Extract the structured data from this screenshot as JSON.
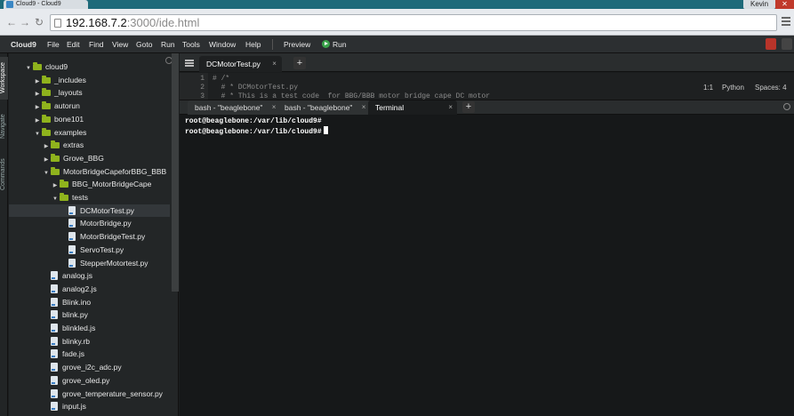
{
  "browser": {
    "tab_title": "Cloud9 - Cloud9",
    "user_name": "Kevin",
    "url_host": "192.168.7.2",
    "url_rest": ":3000/ide.html",
    "back_glyph": "←",
    "forward_glyph": "→",
    "reload_glyph": "↻",
    "minimize_glyph": "—",
    "maximize_glyph": "□",
    "close_glyph": "✕"
  },
  "menubar": {
    "brand": "Cloud9",
    "items": [
      "File",
      "Edit",
      "Find",
      "View",
      "Goto",
      "Run",
      "Tools",
      "Window",
      "Help"
    ],
    "preview": "Preview",
    "run": "Run"
  },
  "rail": {
    "items": [
      "Workspace",
      "Navigate",
      "Commands"
    ]
  },
  "tree": {
    "nodes": [
      {
        "label": "cloud9",
        "kind": "folder",
        "open": true
      },
      {
        "label": "_includes",
        "kind": "folder",
        "open": false
      },
      {
        "label": "_layouts",
        "kind": "folder",
        "open": false
      },
      {
        "label": "autorun",
        "kind": "folder",
        "open": false
      },
      {
        "label": "bone101",
        "kind": "folder",
        "open": false
      },
      {
        "label": "examples",
        "kind": "folder",
        "open": true
      },
      {
        "label": "extras",
        "kind": "folder",
        "open": false
      },
      {
        "label": "Grove_BBG",
        "kind": "folder",
        "open": false
      },
      {
        "label": "MotorBridgeCapeforBBG_BBB",
        "kind": "folder",
        "open": true
      },
      {
        "label": "BBG_MotorBridgeCape",
        "kind": "folder",
        "open": false
      },
      {
        "label": "tests",
        "kind": "folder",
        "open": true
      },
      {
        "label": "DCMotorTest.py",
        "kind": "file"
      },
      {
        "label": "MotorBridge.py",
        "kind": "file"
      },
      {
        "label": "MotorBridgeTest.py",
        "kind": "file"
      },
      {
        "label": "ServoTest.py",
        "kind": "file"
      },
      {
        "label": "StepperMotortest.py",
        "kind": "file"
      },
      {
        "label": "analog.js",
        "kind": "file"
      },
      {
        "label": "analog2.js",
        "kind": "file"
      },
      {
        "label": "Blink.ino",
        "kind": "file"
      },
      {
        "label": "blink.py",
        "kind": "file"
      },
      {
        "label": "blinkled.js",
        "kind": "file"
      },
      {
        "label": "blinky.rb",
        "kind": "file"
      },
      {
        "label": "fade.js",
        "kind": "file"
      },
      {
        "label": "grove_i2c_adc.py",
        "kind": "file"
      },
      {
        "label": "grove_oled.py",
        "kind": "file"
      },
      {
        "label": "grove_temperature_sensor.py",
        "kind": "file"
      },
      {
        "label": "input.js",
        "kind": "file"
      }
    ],
    "selected_label": "DCMotorTest.py"
  },
  "editor": {
    "tab_label": "DCMotorTest.py",
    "tab_close": "×",
    "add_tab": "+",
    "line_numbers": [
      "1",
      "2",
      "3"
    ],
    "lines": [
      "# /*",
      "  # * DCMotorTest.py",
      "  # * This is a test code  for BBG/BBB motor bridge cape DC motor"
    ],
    "status": {
      "position": "1:1",
      "language": "Python",
      "spaces": "Spaces: 4"
    }
  },
  "terminal": {
    "tabs": [
      {
        "label": "bash - \"beaglebone\"",
        "active": false
      },
      {
        "label": "bash - \"beaglebone\"",
        "active": false
      },
      {
        "label": "Terminal",
        "active": true
      }
    ],
    "tab_close": "×",
    "add_tab": "+",
    "lines": [
      "root@beaglebone:/var/lib/cloud9#",
      "root@beaglebone:/var/lib/cloud9#"
    ]
  },
  "colors": {
    "folder": "#8fb31d",
    "run_green": "#3aa24a",
    "menubar_bg": "#2c2f31",
    "terminal_bg": "#161819"
  }
}
